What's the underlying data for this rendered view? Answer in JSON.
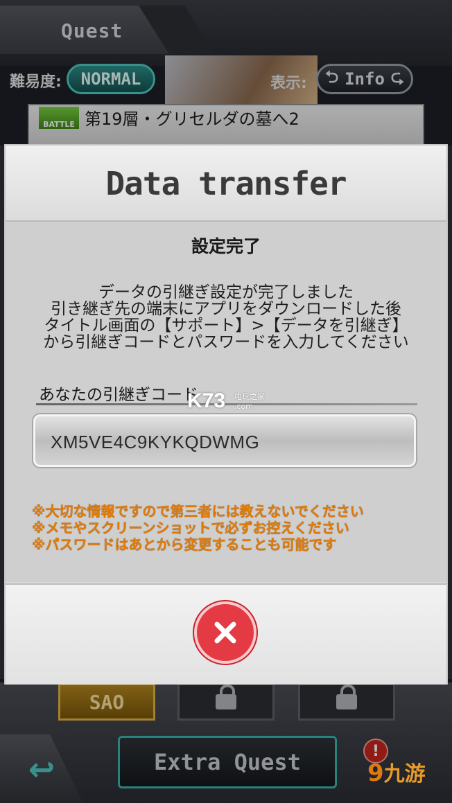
{
  "header": {
    "title": "Quest",
    "difficulty_label": "難易度:",
    "difficulty_value": "NORMAL",
    "display_label": "表示:",
    "display_toggle": "Info"
  },
  "quest_row": {
    "tag": "BATTLE",
    "name": "第19層・グリセルダの墓へ2"
  },
  "bottom_nav": {
    "sao_tab": "SAO",
    "extra_quest": "Extra Quest",
    "notification": "!"
  },
  "dialog": {
    "title": "Data transfer",
    "status": "設定完了",
    "instructions": [
      "データの引継ぎ設定が完了しました",
      "引き継ぎ先の端末にアプリをダウンロードした後",
      "タイトル画面の【サポート】>【データを引継ぎ】",
      "から引継ぎコードとパスワードを入力してください"
    ],
    "code_label": "あなたの引継ぎコード",
    "code_value": "XM5VE4C9KYKQDWMG",
    "warnings": [
      "※大切な情報ですので第三者には教えないでください",
      "※メモやスクリーンショットで必ずお控えください",
      "※パスワードはあとから変更することも可能です"
    ]
  },
  "watermarks": {
    "k73": "K73",
    "k73_sub": "电玩之家",
    "k73_sub_domain": ".com",
    "ninegame": "九游"
  },
  "colors": {
    "accent_teal": "#4ec9c1",
    "warning_orange": "#e07b0a",
    "close_red": "#e43a44"
  }
}
